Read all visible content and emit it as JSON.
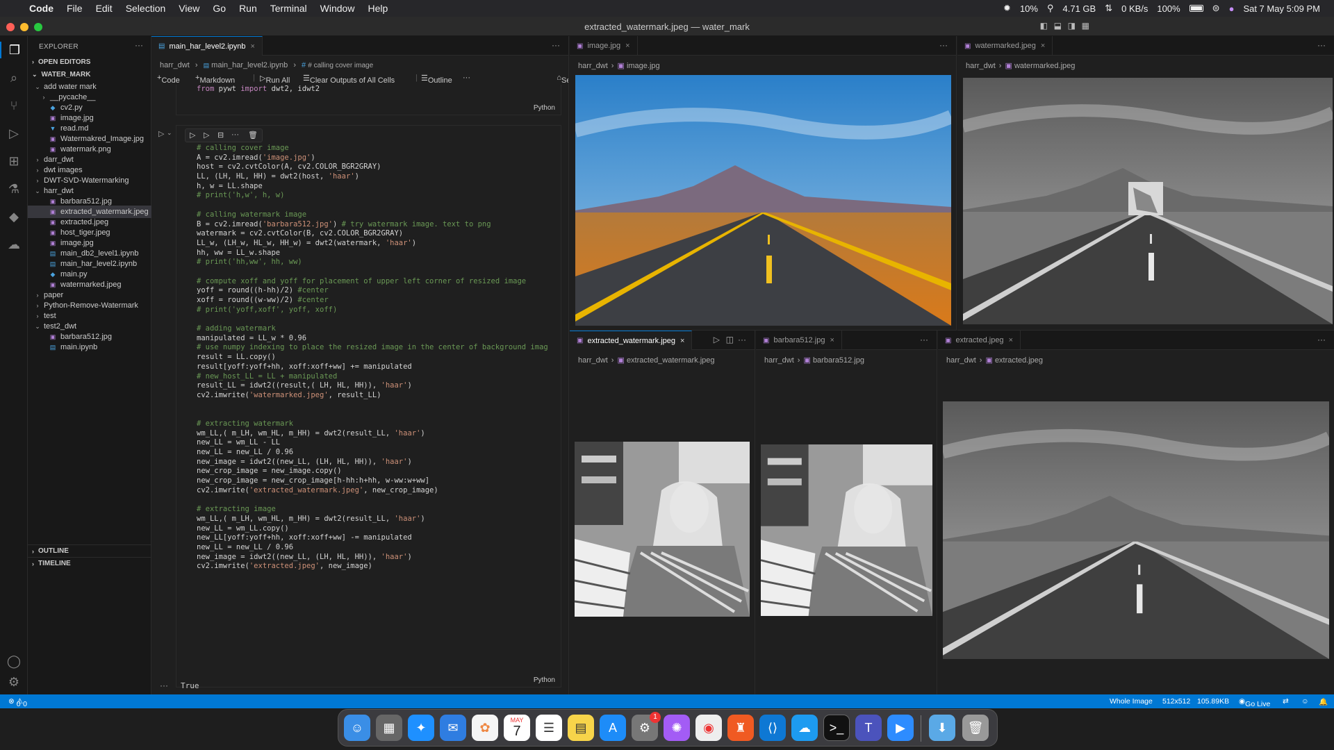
{
  "menubar": {
    "app_name": "Code",
    "items": [
      "File",
      "Edit",
      "Selection",
      "View",
      "Go",
      "Run",
      "Terminal",
      "Window",
      "Help"
    ],
    "status": {
      "cpu": "10%",
      "mem": "4.71 GB",
      "net": "0 KB/s",
      "battery": "100%",
      "datetime": "Sat 7 May  5:09 PM"
    }
  },
  "window": {
    "title": "extracted_watermark.jpeg — water_mark"
  },
  "explorer": {
    "header": "EXPLORER",
    "open_editors": "OPEN EDITORS",
    "root": "WATER_MARK",
    "tree": [
      {
        "label": "add water mark",
        "type": "folder-open",
        "indent": 1
      },
      {
        "label": "__pycache__",
        "type": "folder",
        "indent": 2
      },
      {
        "label": "cv2.py",
        "type": "py",
        "indent": 2
      },
      {
        "label": "image.jpg",
        "type": "img",
        "indent": 2
      },
      {
        "label": "read.md",
        "type": "md",
        "indent": 2
      },
      {
        "label": "Watermakred_Image.jpg",
        "type": "img",
        "indent": 2
      },
      {
        "label": "watermark.png",
        "type": "img",
        "indent": 2
      },
      {
        "label": "darr_dwt",
        "type": "folder",
        "indent": 1
      },
      {
        "label": "dwt images",
        "type": "folder",
        "indent": 1
      },
      {
        "label": "DWT-SVD-Watermarking",
        "type": "folder",
        "indent": 1
      },
      {
        "label": "harr_dwt",
        "type": "folder-open",
        "indent": 1
      },
      {
        "label": "barbara512.jpg",
        "type": "img",
        "indent": 2
      },
      {
        "label": "extracted_watermark.jpeg",
        "type": "img",
        "indent": 2,
        "selected": true
      },
      {
        "label": "extracted.jpeg",
        "type": "img",
        "indent": 2
      },
      {
        "label": "host_tiger.jpeg",
        "type": "img",
        "indent": 2
      },
      {
        "label": "image.jpg",
        "type": "img",
        "indent": 2
      },
      {
        "label": "main_db2_level1.ipynb",
        "type": "nb",
        "indent": 2
      },
      {
        "label": "main_har_level2.ipynb",
        "type": "nb",
        "indent": 2
      },
      {
        "label": "main.py",
        "type": "py",
        "indent": 2
      },
      {
        "label": "watermarked.jpeg",
        "type": "img",
        "indent": 2
      },
      {
        "label": "paper",
        "type": "folder",
        "indent": 1
      },
      {
        "label": "Python-Remove-Watermark",
        "type": "folder",
        "indent": 1
      },
      {
        "label": "test",
        "type": "folder",
        "indent": 1
      },
      {
        "label": "test2_dwt",
        "type": "folder-open",
        "indent": 1
      },
      {
        "label": "barbara512.jpg",
        "type": "img",
        "indent": 2
      },
      {
        "label": "main.ipynb",
        "type": "nb",
        "indent": 2
      }
    ],
    "outline": "OUTLINE",
    "timeline": "TIMELINE"
  },
  "notebook": {
    "tab": "main_har_level2.ipynb",
    "breadcrumb": [
      "harr_dwt",
      "main_har_level2.ipynb",
      "# calling cover image"
    ],
    "toolbar": {
      "code": "Code",
      "markdown": "Markdown",
      "run_all": "Run All",
      "clear": "Clear Outputs of All Cells",
      "outline": "Outline",
      "kernel": "Select Kernel"
    },
    "prev_cell_last_line": "from pywt import dwt2, idwt2",
    "lang": "Python",
    "output": "True",
    "code_lines": [
      "# calling cover image",
      "A = cv2.imread('image.jpg')",
      "host = cv2.cvtColor(A, cv2.COLOR_BGR2GRAY)",
      "LL, (LH, HL, HH) = dwt2(host, 'haar')",
      "h, w = LL.shape",
      "# print('h,w', h, w)",
      "",
      "# calling watermark image",
      "B = cv2.imread('barbara512.jpg') # try watermark image. text to png",
      "watermark = cv2.cvtColor(B, cv2.COLOR_BGR2GRAY)",
      "LL_w, (LH_w, HL_w, HH_w) = dwt2(watermark, 'haar')",
      "hh, ww = LL_w.shape",
      "# print('hh,ww', hh, ww)",
      "",
      "# compute xoff and yoff for placement of upper left corner of resized image",
      "yoff = round((h-hh)/2) #center",
      "xoff = round((w-ww)/2) #center",
      "# print('yoff,xoff', yoff, xoff)",
      "",
      "# adding watermark",
      "manipulated = LL_w * 0.96",
      "# use numpy indexing to place the resized image in the center of background imag",
      "result = LL.copy()",
      "result[yoff:yoff+hh, xoff:xoff+ww] += manipulated",
      "# new_host_LL = LL + manipulated",
      "result_LL = idwt2((result,( LH, HL, HH)), 'haar')",
      "cv2.imwrite('watermarked.jpeg', result_LL)",
      "",
      "",
      "# extracting watermark",
      "wm_LL,( m_LH, wm_HL, m_HH) = dwt2(result_LL, 'haar')",
      "new_LL = wm_LL - LL",
      "new_LL = new_LL / 0.96",
      "new_image = idwt2((new_LL, (LH, HL, HH)), 'haar')",
      "new_crop_image = new_image.copy()",
      "new_crop_image = new_crop_image[h-hh:h+hh, w-ww:w+ww]",
      "cv2.imwrite('extracted_watermark.jpeg', new_crop_image)",
      "",
      "# extracting image",
      "wm_LL,( m_LH, wm_HL, m_HH) = dwt2(result_LL, 'haar')",
      "new_LL = wm_LL.copy()",
      "new_LL[yoff:yoff+hh, xoff:xoff+ww] -= manipulated",
      "new_LL = new_LL / 0.96",
      "new_image = idwt2((new_LL, (LH, HL, HH)), 'haar')",
      "cv2.imwrite('extracted.jpeg', new_image)"
    ]
  },
  "panels": {
    "image": {
      "tab": "image.jpg",
      "crumb": [
        "harr_dwt",
        "image.jpg"
      ]
    },
    "watermarked": {
      "tab": "watermarked.jpeg",
      "crumb": [
        "harr_dwt",
        "watermarked.jpeg"
      ]
    },
    "extracted_watermark": {
      "tab": "extracted_watermark.jpeg",
      "crumb": [
        "harr_dwt",
        "extracted_watermark.jpeg"
      ]
    },
    "barbara": {
      "tab": "barbara512.jpg",
      "crumb": [
        "harr_dwt",
        "barbara512.jpg"
      ]
    },
    "extracted": {
      "tab": "extracted.jpeg",
      "crumb": [
        "harr_dwt",
        "extracted.jpeg"
      ]
    }
  },
  "statusbar": {
    "problems": "0",
    "warnings": "0",
    "whole_image": "Whole Image",
    "dims": "512x512",
    "size": "105.89KB",
    "golive": "Go Live"
  },
  "dock": {
    "calendar_month": "MAY",
    "calendar_day": "7",
    "badge": "1"
  }
}
